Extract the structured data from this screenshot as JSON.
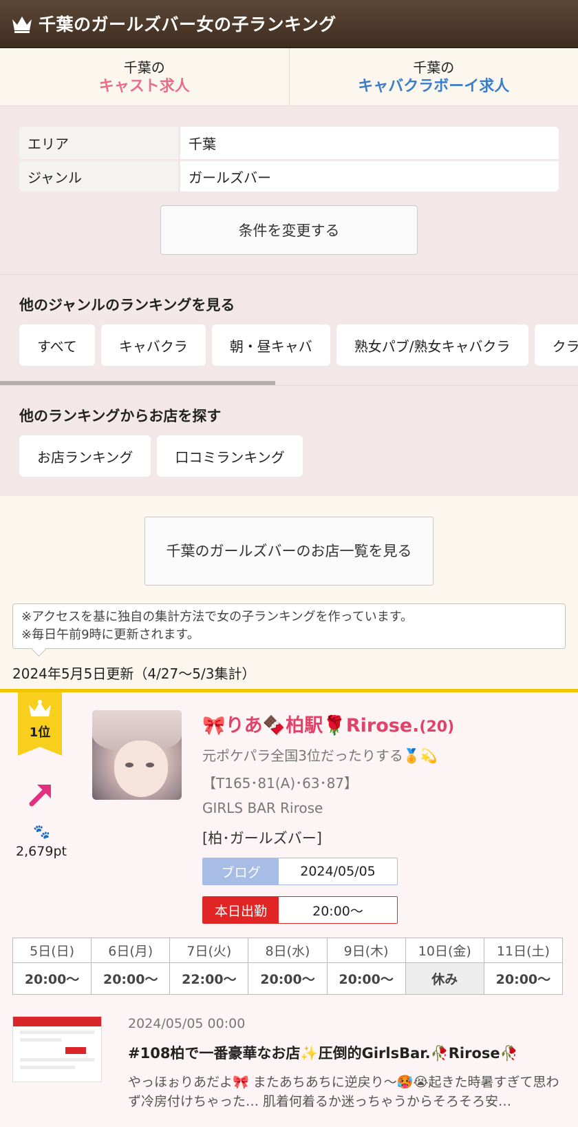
{
  "header": {
    "title": "千葉のガールズバー女の子ランキング"
  },
  "tabs": [
    {
      "line1": "千葉の",
      "line2": "キャスト求人"
    },
    {
      "line1": "千葉の",
      "line2": "キャバクラボーイ求人"
    }
  ],
  "filter": {
    "rows": [
      {
        "key": "エリア",
        "value": "千葉"
      },
      {
        "key": "ジャンル",
        "value": "ガールズバー"
      }
    ],
    "change_button": "条件を変更する"
  },
  "genres": {
    "title": "他のジャンルのランキングを見る",
    "items": [
      "すべて",
      "キャバクラ",
      "朝・昼キャバ",
      "熟女パブ/熟女キャバクラ",
      "クラ"
    ]
  },
  "other_rankings": {
    "title": "他のランキングからお店を探す",
    "items": [
      "お店ランキング",
      "口コミランキング"
    ]
  },
  "shop_list_button": "千葉のガールズバーのお店一覧を見る",
  "note": {
    "line1": "※アクセスを基に独自の集計方法で女の子ランキングを作っています。",
    "line2": "※毎日午前9時に更新されます。"
  },
  "updated": "2024年5月5日更新（4/27〜5/3集計）",
  "ranking": {
    "rank_label": "1位",
    "points": "2,679pt",
    "name": "🎀りあ🍫柏駅🌹Rirose.",
    "age": "(20)",
    "catch": "元ポケパラ全国3位だったりする🏅💫",
    "spec": "【T165･81(A)･63･87】",
    "shop": "GIRLS BAR Rirose",
    "area": "[柏･ガールズバー]",
    "blog_label": "ブログ",
    "blog_date": "2024/05/05",
    "work_label": "本日出勤",
    "work_time": "20:00〜",
    "schedule": [
      {
        "day": "5日(日)",
        "time": "20:00〜"
      },
      {
        "day": "6日(月)",
        "time": "20:00〜"
      },
      {
        "day": "7日(火)",
        "time": "22:00〜"
      },
      {
        "day": "8日(水)",
        "time": "20:00〜"
      },
      {
        "day": "9日(木)",
        "time": "20:00〜"
      },
      {
        "day": "10日(金)",
        "time": "休み"
      },
      {
        "day": "11日(土)",
        "time": "20:00〜"
      }
    ],
    "post": {
      "date": "2024/05/05 00:00",
      "title": "#108柏で一番豪華なお店✨圧倒的GirlsBar.🥀Rirose🥀",
      "body": "やっほぉりあだよ🎀 またあちあちに逆戻り〜🥵😭起きた時暑すぎて思わず冷房付けちゃった… 肌着何着るか迷っちゃうからそろそろ安…"
    }
  },
  "colors": {
    "accent_pink": "#e86f8a",
    "accent_blue": "#3b7dc8",
    "gold": "#f1c400",
    "name_red": "#e0426a"
  },
  "icons": [
    "crown-icon",
    "arrow-up-right-icon",
    "paw-icon"
  ]
}
